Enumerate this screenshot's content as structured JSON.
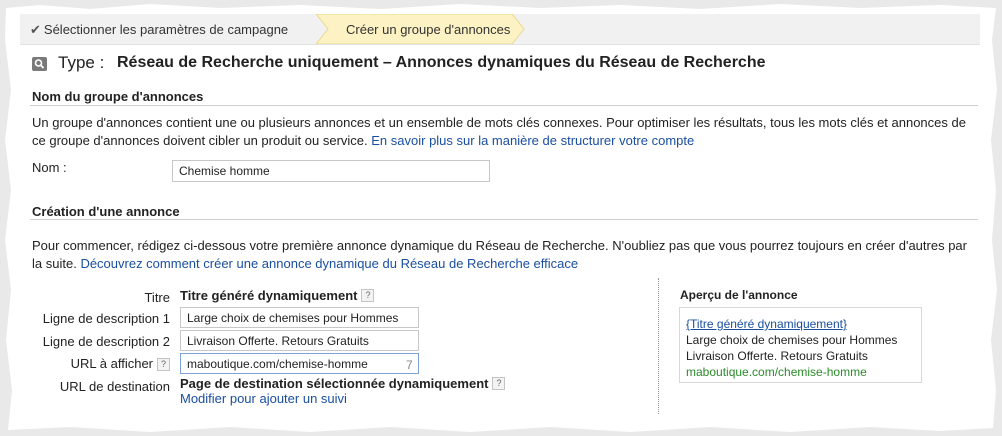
{
  "breadcrumb": {
    "step1": "Sélectionner les paramètres de campagne",
    "step2": "Créer un groupe d'annonces"
  },
  "type": {
    "label": "Type :",
    "value": "Réseau de Recherche uniquement – Annonces dynamiques du Réseau de Recherche"
  },
  "adgroup": {
    "heading": "Nom du groupe d'annonces",
    "description": "Un groupe d'annonces contient une ou plusieurs annonces et un ensemble de mots clés connexes. Pour optimiser les résultats, tous les mots clés et annonces de ce groupe d'annonces doivent cibler un produit ou service.",
    "link": "En savoir plus sur la manière de structurer votre compte",
    "name_label": "Nom :",
    "name_value": "Chemise homme"
  },
  "ad": {
    "heading": "Création d'une annonce",
    "description": "Pour commencer, rédigez ci-dessous votre première annonce dynamique du Réseau de Recherche. N'oubliez pas que vous pourrez toujours en créer d'autres par la suite.",
    "link": "Découvrez comment créer une annonce dynamique du Réseau de Recherche efficace",
    "title_label": "Titre",
    "title_value": "Titre généré dynamiquement",
    "desc1_label": "Ligne de description 1",
    "desc1_value": "Large choix de chemises pour Hommes",
    "desc2_label": "Ligne de description 2",
    "desc2_value": "Livraison Offerte. Retours Gratuits",
    "display_url_label": "URL à afficher",
    "display_url_value": "maboutique.com/chemise-homme",
    "display_url_counter": "7",
    "dest_url_label": "URL de destination",
    "dest_url_value": "Page de destination sélectionnée dynamiquement",
    "dest_url_link": "Modifier pour ajouter un suivi",
    "help_glyph": "?"
  },
  "preview": {
    "heading": "Aperçu de l'annonce",
    "title": "{Titre généré dynamiquement}",
    "line1": "Large choix de chemises pour Hommes",
    "line2": "Livraison Offerte. Retours Gratuits",
    "url": "maboutique.com/chemise-homme"
  },
  "colors": {
    "link": "#1a4fa0",
    "active_step": "#fdf2c3",
    "preview_url": "#2a8a2a"
  }
}
